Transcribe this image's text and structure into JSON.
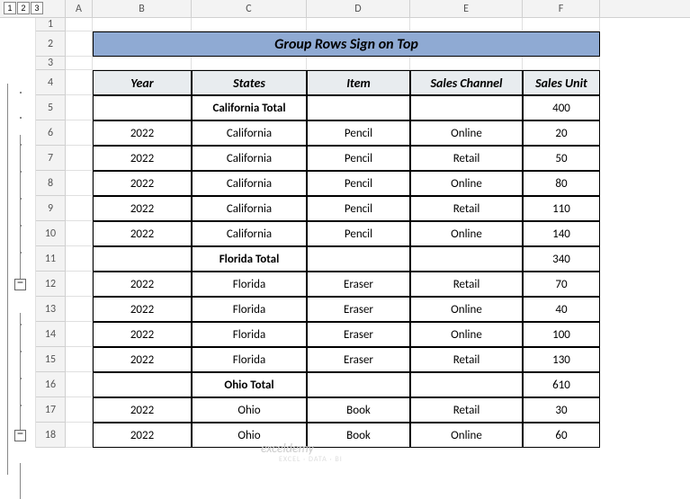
{
  "outline_levels": [
    "1",
    "2",
    "3"
  ],
  "columns": [
    "A",
    "B",
    "C",
    "D",
    "E",
    "F"
  ],
  "title": "Group Rows Sign on Top",
  "headers": {
    "year": "Year",
    "states": "States",
    "item": "Item",
    "channel": "Sales Channel",
    "unit": "Sales Unit"
  },
  "collapse_glyph": "−",
  "watermark": "exceldemy",
  "watermark_sub": "EXCEL · DATA · BI",
  "rows": [
    {
      "n": "1",
      "type": "blank"
    },
    {
      "n": "2",
      "type": "title"
    },
    {
      "n": "3",
      "type": "blank"
    },
    {
      "n": "4",
      "type": "header"
    },
    {
      "n": "5",
      "type": "total",
      "states": "California Total",
      "unit": "400"
    },
    {
      "n": "6",
      "type": "data",
      "year": "2022",
      "states": "California",
      "item": "Pencil",
      "channel": "Online",
      "unit": "20"
    },
    {
      "n": "7",
      "type": "data",
      "year": "2022",
      "states": "California",
      "item": "Pencil",
      "channel": "Retail",
      "unit": "50"
    },
    {
      "n": "8",
      "type": "data",
      "year": "2022",
      "states": "California",
      "item": "Pencil",
      "channel": "Online",
      "unit": "80"
    },
    {
      "n": "9",
      "type": "data",
      "year": "2022",
      "states": "California",
      "item": "Pencil",
      "channel": "Retail",
      "unit": "110"
    },
    {
      "n": "10",
      "type": "data",
      "year": "2022",
      "states": "California",
      "item": "Pencil",
      "channel": "Online",
      "unit": "140"
    },
    {
      "n": "11",
      "type": "total",
      "states": "Florida Total",
      "unit": "340"
    },
    {
      "n": "12",
      "type": "data",
      "year": "2022",
      "states": "Florida",
      "item": "Eraser",
      "channel": "Retail",
      "unit": "70"
    },
    {
      "n": "13",
      "type": "data",
      "year": "2022",
      "states": "Florida",
      "item": "Eraser",
      "channel": "Online",
      "unit": "40"
    },
    {
      "n": "14",
      "type": "data",
      "year": "2022",
      "states": "Florida",
      "item": "Eraser",
      "channel": "Online",
      "unit": "100"
    },
    {
      "n": "15",
      "type": "data",
      "year": "2022",
      "states": "Florida",
      "item": "Eraser",
      "channel": "Retail",
      "unit": "130"
    },
    {
      "n": "16",
      "type": "total",
      "states": "Ohio Total",
      "unit": "610"
    },
    {
      "n": "17",
      "type": "data",
      "year": "2022",
      "states": "Ohio",
      "item": "Book",
      "channel": "Retail",
      "unit": "30"
    },
    {
      "n": "18",
      "type": "data",
      "year": "2022",
      "states": "Ohio",
      "item": "Book",
      "channel": "Online",
      "unit": "60"
    }
  ]
}
